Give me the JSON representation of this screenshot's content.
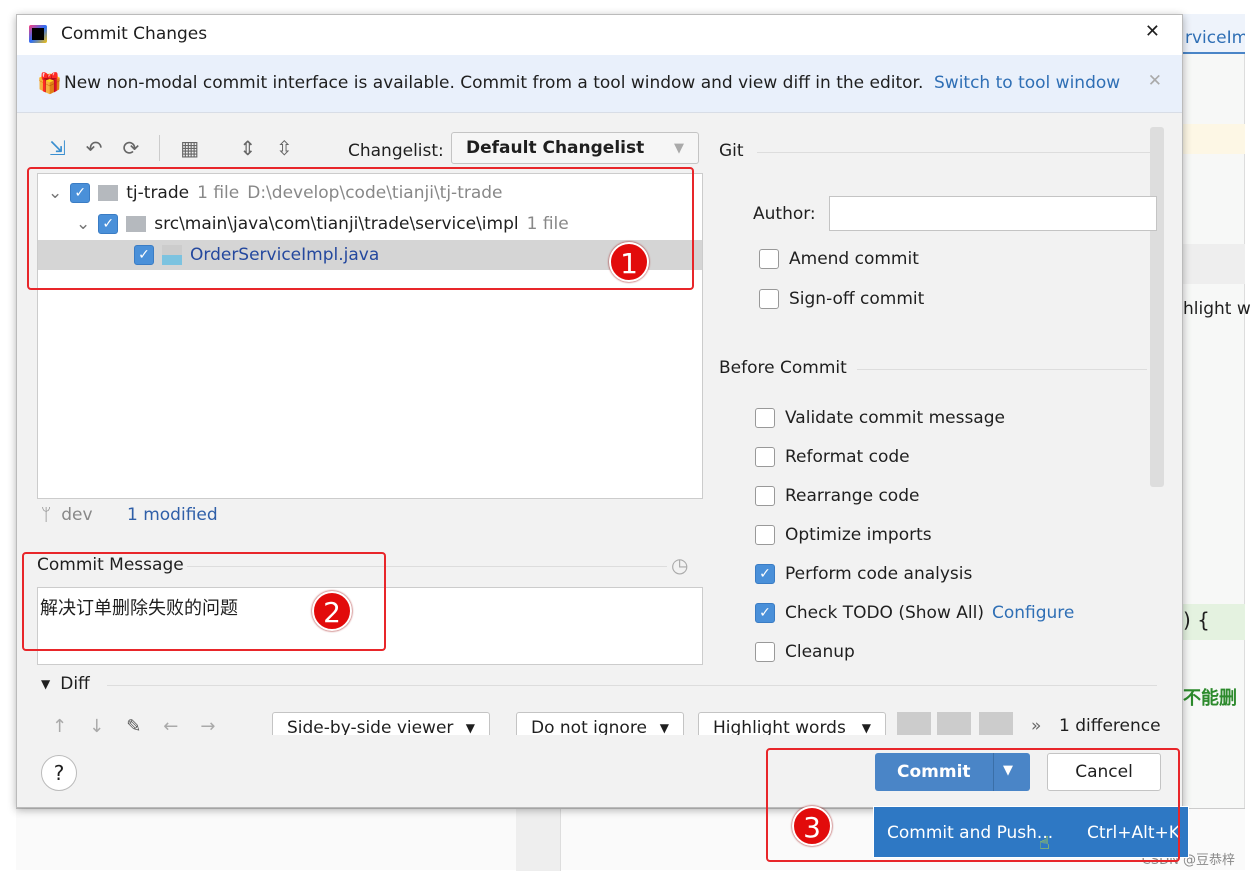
{
  "window": {
    "title": "Commit Changes",
    "close": "✕"
  },
  "banner": {
    "text": "New non-modal commit interface is available. Commit from a tool window and view diff in the editor.",
    "link": "Switch to tool window",
    "close": "✕"
  },
  "toolbar": {
    "changelist_label": "Changelist:",
    "changelist_value": "Default Changelist"
  },
  "tree": [
    {
      "name": "tj-trade",
      "count": "1 file",
      "path": "D:\\develop\\code\\tianji\\tj-trade"
    },
    {
      "name": "src\\main\\java\\com\\tianji\\trade\\service\\impl",
      "count": "1 file"
    },
    {
      "name": "OrderServiceImpl.java"
    }
  ],
  "status": {
    "branch": "dev",
    "modified": "1 modified"
  },
  "commit_message": {
    "label": "Commit Message",
    "value": "解决订单删除失败的问题"
  },
  "git": {
    "title": "Git",
    "author_label": "Author:",
    "author_value": "",
    "amend": "Amend commit",
    "signoff": "Sign-off commit"
  },
  "before_commit": {
    "title": "Before Commit",
    "options": [
      {
        "label": "Validate commit message",
        "checked": false
      },
      {
        "label": "Reformat code",
        "checked": false
      },
      {
        "label": "Rearrange code",
        "checked": false
      },
      {
        "label": "Optimize imports",
        "checked": false
      },
      {
        "label": "Perform code analysis",
        "checked": true
      },
      {
        "label": "Check TODO (Show All)",
        "checked": true,
        "link": "Configure"
      },
      {
        "label": "Cleanup",
        "checked": false
      }
    ]
  },
  "diff": {
    "title": "Diff",
    "viewer": "Side-by-side viewer",
    "ignore": "Do not ignore",
    "highlight": "Highlight words",
    "differences": "1 difference"
  },
  "buttons": {
    "help": "?",
    "commit": "Commit",
    "cancel": "Cancel"
  },
  "dropdown": {
    "item": "Commit and Push...",
    "shortcut": "Ctrl+Alt+K"
  },
  "annotations": [
    "1",
    "2",
    "3"
  ],
  "background": {
    "tab": "rviceImp",
    "text1": "hlight w",
    "text2": ") {",
    "text3": "不能删",
    "watermark": "CSDN @豆恭梓"
  },
  "colors": {
    "accent": "#4a85c7",
    "link": "#2f6fb5",
    "annotation": "#e8262a"
  }
}
